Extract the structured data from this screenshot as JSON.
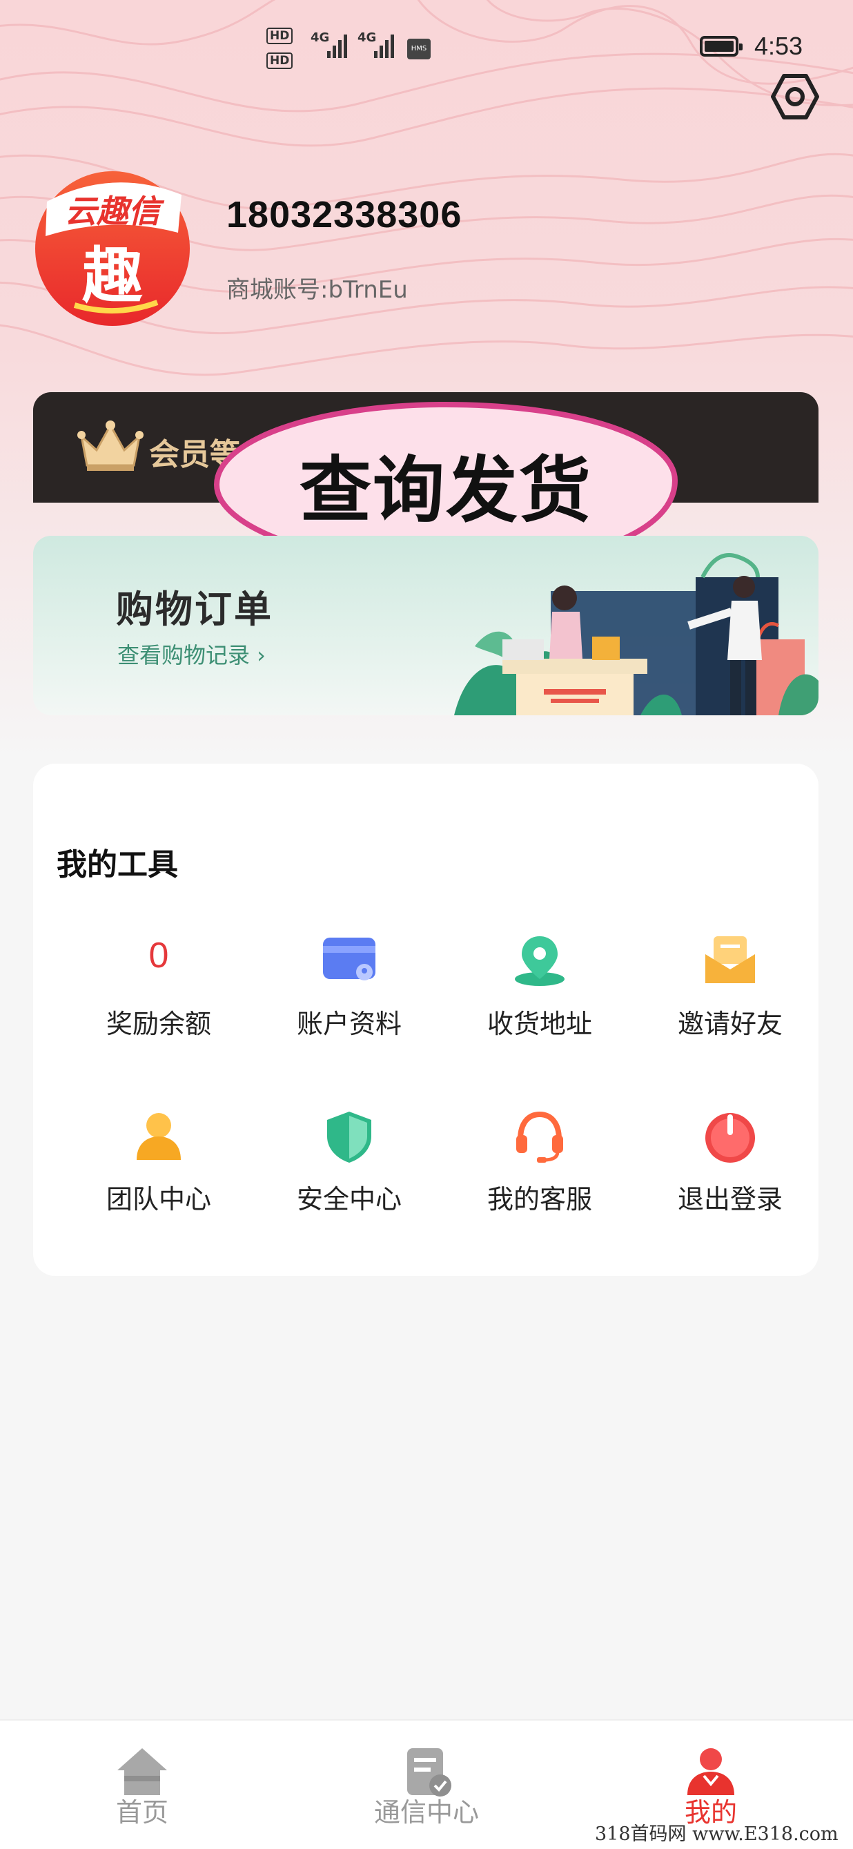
{
  "status_bar": {
    "hd1": "HD",
    "hd2": "HD",
    "net1": "4G",
    "net2": "4G",
    "hms": "HMS",
    "time": "4:53"
  },
  "profile": {
    "phone": "18032338306",
    "account": "商城账号:bTrnEu"
  },
  "member": {
    "label": "会员等"
  },
  "bubble": {
    "text": "查询发货"
  },
  "orders": {
    "title": "购物订单",
    "subtitle": "查看购物记录 ›"
  },
  "tools": {
    "title": "我的工具",
    "items": [
      {
        "label": "奖励余额",
        "value": "0"
      },
      {
        "label": "账户资料",
        "icon": "account-card-icon"
      },
      {
        "label": "收货地址",
        "icon": "location-icon"
      },
      {
        "label": "邀请好友",
        "icon": "invite-mail-icon"
      },
      {
        "label": "团队中心",
        "icon": "team-icon"
      },
      {
        "label": "安全中心",
        "icon": "shield-icon"
      },
      {
        "label": "我的客服",
        "icon": "headset-icon"
      },
      {
        "label": "退出登录",
        "icon": "power-icon"
      }
    ]
  },
  "nav": {
    "items": [
      {
        "label": "首页",
        "icon": "home-icon"
      },
      {
        "label": "通信中心",
        "icon": "document-check-icon"
      },
      {
        "label": "我的",
        "icon": "user-icon",
        "active": true
      }
    ]
  },
  "watermark": "318首码网 www.E318.com",
  "colors": {
    "accent": "#e8332e",
    "header_bg": "#f9d6d8",
    "member_bg": "#2a2524",
    "member_gold": "#e6c89a",
    "orders_green": "#3d8f74"
  }
}
